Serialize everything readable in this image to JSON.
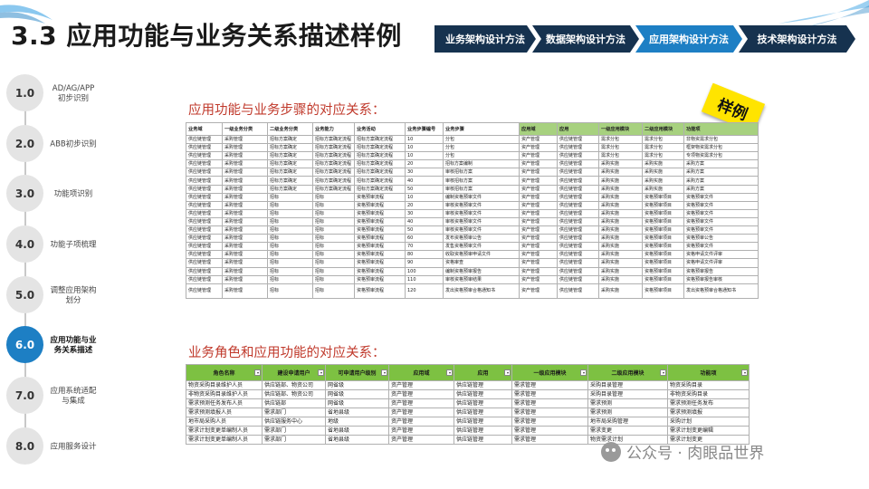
{
  "title": "3.3 应用功能与业务关系描述样例",
  "brand_colors": {
    "dark": "#16324f",
    "active": "#1d7fc4",
    "header_green": "#7dc142",
    "heading_red": "#c0392b"
  },
  "nav_tabs": [
    {
      "label": "业务架构设计方法",
      "active": false
    },
    {
      "label": "数据架构设计方法",
      "active": false
    },
    {
      "label": "应用架构设计方法",
      "active": true
    },
    {
      "label": "技术架构设计方法",
      "active": false
    }
  ],
  "timeline": [
    {
      "num": "1.0",
      "label": "AD/AG/APP初步识别",
      "active": false
    },
    {
      "num": "2.0",
      "label": "ABB初步识别",
      "active": false
    },
    {
      "num": "3.0",
      "label": "功能项识别",
      "active": false
    },
    {
      "num": "4.0",
      "label": "功能子项梳理",
      "active": false
    },
    {
      "num": "5.0",
      "label": "调整应用架构划分",
      "active": false
    },
    {
      "num": "6.0",
      "label": "应用功能与业务关系描述",
      "active": true
    },
    {
      "num": "7.0",
      "label": "应用系统适配与集成",
      "active": false
    },
    {
      "num": "8.0",
      "label": "应用服务设计",
      "active": false
    }
  ],
  "section1": {
    "heading": "应用功能与业务步骤的对应关系：",
    "stamp": "样例",
    "headers": [
      "业务域",
      "一级业务分类",
      "二级业务分类",
      "业务能力",
      "业务活动",
      "业务步骤编号",
      "业务步骤",
      "应用域",
      "应用",
      "一级应用模块",
      "二级应用模块",
      "功能项"
    ],
    "rows": [
      [
        "供应链管理",
        "采购管理",
        "招标方案确定",
        "招标方案确定流程",
        "招标方案确定流程",
        "10",
        "分包",
        "资产管理",
        "供应链管理",
        "需求分包",
        "需求分包",
        "非物资需求分包"
      ],
      [
        "供应链管理",
        "采购管理",
        "招标方案确定",
        "招标方案确定流程",
        "招标方案确定流程",
        "10",
        "分包",
        "资产管理",
        "供应链管理",
        "需求分包",
        "需求分包",
        "框架物资需求分包"
      ],
      [
        "供应链管理",
        "采购管理",
        "招标方案确定",
        "招标方案确定流程",
        "招标方案确定流程",
        "10",
        "分包",
        "资产管理",
        "供应链管理",
        "需求分包",
        "需求分包",
        "专项物资需求分包"
      ],
      [
        "供应链管理",
        "采购管理",
        "招标方案确定",
        "招标方案确定流程",
        "招标方案确定流程",
        "20",
        "招标方案编制",
        "资产管理",
        "供应链管理",
        "采购实施",
        "采购实施",
        "采购方案"
      ],
      [
        "供应链管理",
        "采购管理",
        "招标方案确定",
        "招标方案确定流程",
        "招标方案确定流程",
        "30",
        "审核招标方案",
        "资产管理",
        "供应链管理",
        "采购实施",
        "采购实施",
        "采购方案"
      ],
      [
        "供应链管理",
        "采购管理",
        "招标方案确定",
        "招标方案确定流程",
        "招标方案确定流程",
        "40",
        "审核招标方案",
        "资产管理",
        "供应链管理",
        "采购实施",
        "采购实施",
        "采购方案"
      ],
      [
        "供应链管理",
        "采购管理",
        "招标方案确定",
        "招标方案确定流程",
        "招标方案确定流程",
        "50",
        "审核招标方案",
        "资产管理",
        "供应链管理",
        "采购实施",
        "采购实施",
        "采购方案"
      ],
      [
        "供应链管理",
        "采购管理",
        "招标",
        "招标",
        "资格预审流程",
        "10",
        "编制资格预审文件",
        "资产管理",
        "供应链管理",
        "采购实施",
        "资格预审项目",
        "资格预审文件"
      ],
      [
        "供应链管理",
        "采购管理",
        "招标",
        "招标",
        "资格预审流程",
        "20",
        "审核资格预审文件",
        "资产管理",
        "供应链管理",
        "采购实施",
        "资格预审项目",
        "资格预审文件"
      ],
      [
        "供应链管理",
        "采购管理",
        "招标",
        "招标",
        "资格预审流程",
        "30",
        "审核资格预审文件",
        "资产管理",
        "供应链管理",
        "采购实施",
        "资格预审项目",
        "资格预审文件"
      ],
      [
        "供应链管理",
        "采购管理",
        "招标",
        "招标",
        "资格预审流程",
        "40",
        "审核资格预审文件",
        "资产管理",
        "供应链管理",
        "采购实施",
        "资格预审项目",
        "资格预审文件"
      ],
      [
        "供应链管理",
        "采购管理",
        "招标",
        "招标",
        "资格预审流程",
        "50",
        "审核资格预审文件",
        "资产管理",
        "供应链管理",
        "采购实施",
        "资格预审项目",
        "资格预审文件"
      ],
      [
        "供应链管理",
        "采购管理",
        "招标",
        "招标",
        "资格预审流程",
        "60",
        "发布资格预审公告",
        "资产管理",
        "供应链管理",
        "采购实施",
        "资格预审项目",
        "资格预审公告"
      ],
      [
        "供应链管理",
        "采购管理",
        "招标",
        "招标",
        "资格预审流程",
        "70",
        "发售资格预审文件",
        "资产管理",
        "供应链管理",
        "采购实施",
        "资格预审项目",
        "资格预审文件"
      ],
      [
        "供应链管理",
        "采购管理",
        "招标",
        "招标",
        "资格预审流程",
        "80",
        "收取资格预审申请文件",
        "资产管理",
        "供应链管理",
        "采购实施",
        "资格预审项目",
        "资格申请文件评审"
      ],
      [
        "供应链管理",
        "采购管理",
        "招标",
        "招标",
        "资格预审流程",
        "90",
        "资格审查",
        "资产管理",
        "供应链管理",
        "采购实施",
        "资格预审项目",
        "资格申请文件评审"
      ],
      [
        "供应链管理",
        "采购管理",
        "招标",
        "招标",
        "资格预审流程",
        "100",
        "编制资格预审报告",
        "资产管理",
        "供应链管理",
        "采购实施",
        "资格预审项目",
        "资格预审报告"
      ],
      [
        "供应链管理",
        "采购管理",
        "招标",
        "招标",
        "资格预审流程",
        "110",
        "审核资格预审结果",
        "资产管理",
        "供应链管理",
        "采购实施",
        "资格预审项目",
        "资格预审报告审核"
      ],
      [
        "供应链管理",
        "采购管理",
        "招标",
        "招标",
        "资格预审流程",
        "120",
        "发出资格预审合格通知书",
        "资产管理",
        "供应链管理",
        "采购实施",
        "资格预审项目",
        "发出资格预审合格通知书"
      ]
    ]
  },
  "section2": {
    "heading": "业务角色和应用功能的对应关系：",
    "headers": [
      "角色名称",
      "建设申请用户",
      "可申请用户级别",
      "应用域",
      "应用",
      "一级应用模块",
      "二级应用模块",
      "功能项"
    ],
    "rows": [
      [
        "物资采购目录维护人员",
        "供应链部、物资公司",
        "网省级",
        "资产管理",
        "供应链管理",
        "需求管理",
        "采购目录管理",
        "物资采购目录"
      ],
      [
        "非物资采购目录维护人员",
        "供应链部、物资公司",
        "网省级",
        "资产管理",
        "供应链管理",
        "需求管理",
        "采购目录管理",
        "非物资采购目录"
      ],
      [
        "需求预测任务发布人员",
        "供应链部",
        "网省级",
        "资产管理",
        "供应链管理",
        "需求管理",
        "需求预测",
        "需求预测任务发布"
      ],
      [
        "需求预测填报人员",
        "需求部门",
        "省地县级",
        "资产管理",
        "供应链管理",
        "需求管理",
        "需求预测",
        "需求预测填报"
      ],
      [
        "地市局采购人员",
        "供应链服务中心",
        "地级",
        "资产管理",
        "供应链管理",
        "需求管理",
        "地市局采购管理",
        "采购计划"
      ],
      [
        "需求计划变更单编制人员",
        "需求部门",
        "省地县级",
        "资产管理",
        "供应链管理",
        "需求管理",
        "需求变更",
        "需求计划变更编辑"
      ],
      [
        "需求计划变更单编制人员",
        "需求部门",
        "省地县级",
        "资产管理",
        "供应链管理",
        "需求管理",
        "物资需求计划",
        "需求计划变更"
      ]
    ]
  },
  "watermark": "公众号 · 肉眼品世界"
}
